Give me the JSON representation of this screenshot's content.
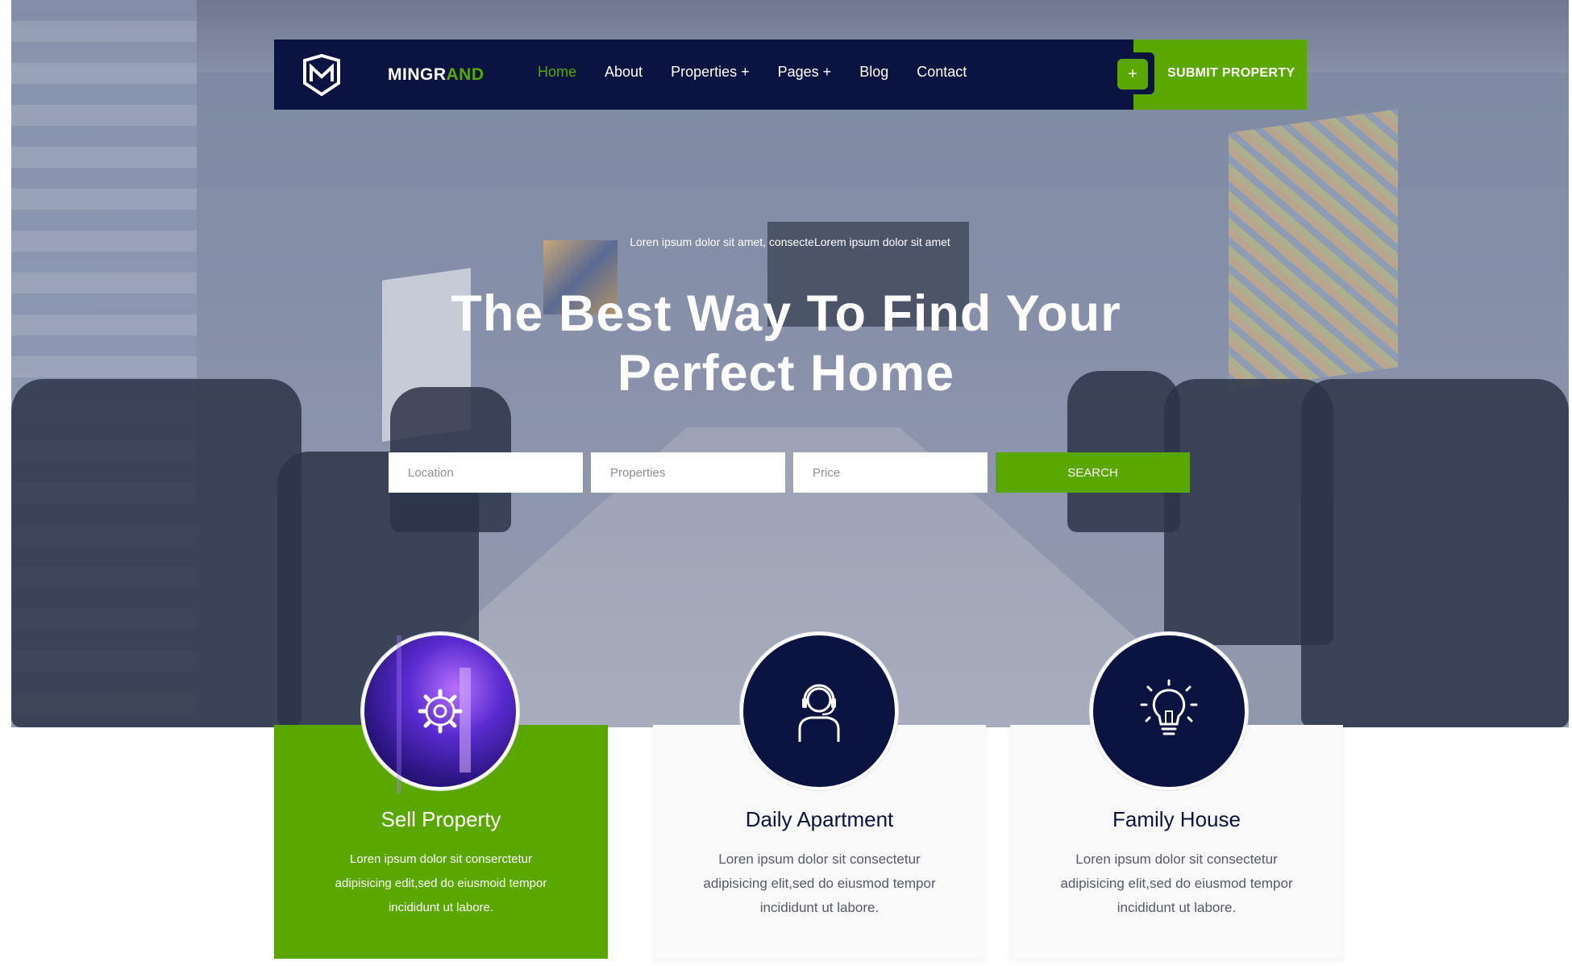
{
  "brand": {
    "name_part1": "MINGR",
    "name_part2": "AND"
  },
  "nav": {
    "items": [
      {
        "label": "Home",
        "active": true
      },
      {
        "label": "About",
        "active": false
      },
      {
        "label": "Properties +",
        "active": false
      },
      {
        "label": "Pages +",
        "active": false
      },
      {
        "label": "Blog",
        "active": false
      },
      {
        "label": "Contact",
        "active": false
      }
    ],
    "submit_plus": "+",
    "submit_label": "SUBMIT PROPERTY"
  },
  "hero": {
    "tagline": "Loren ipsum dolor sit amet, consecteLorem ipsum dolor sit amet",
    "headline": "The Best Way To Find Your\nPerfect Home"
  },
  "search": {
    "location_placeholder": "Location",
    "properties_placeholder": "Properties",
    "price_placeholder": "Price",
    "button_label": "SEARCH"
  },
  "services": [
    {
      "title": "Sell Property",
      "text": "Loren ipsum dolor sit conserctetur\nadipisicing edit,sed do eiusmoid tempor\nincididunt ut  labore.",
      "icon": "gear-icon"
    },
    {
      "title": "Daily Apartment",
      "text": "Loren ipsum dolor sit consectetur\nadipisicing elit,sed do eiusmod tempor\nincididunt ut labore.",
      "icon": "support-agent-icon"
    },
    {
      "title": "Family House",
      "text": "Loren ipsum dolor sit consectetur\nadipisicing elit,sed do eiusmod tempor\nincididunt ut labore.",
      "icon": "lightbulb-icon"
    }
  ],
  "colors": {
    "navy": "#0b1440",
    "green": "#5aa700"
  }
}
